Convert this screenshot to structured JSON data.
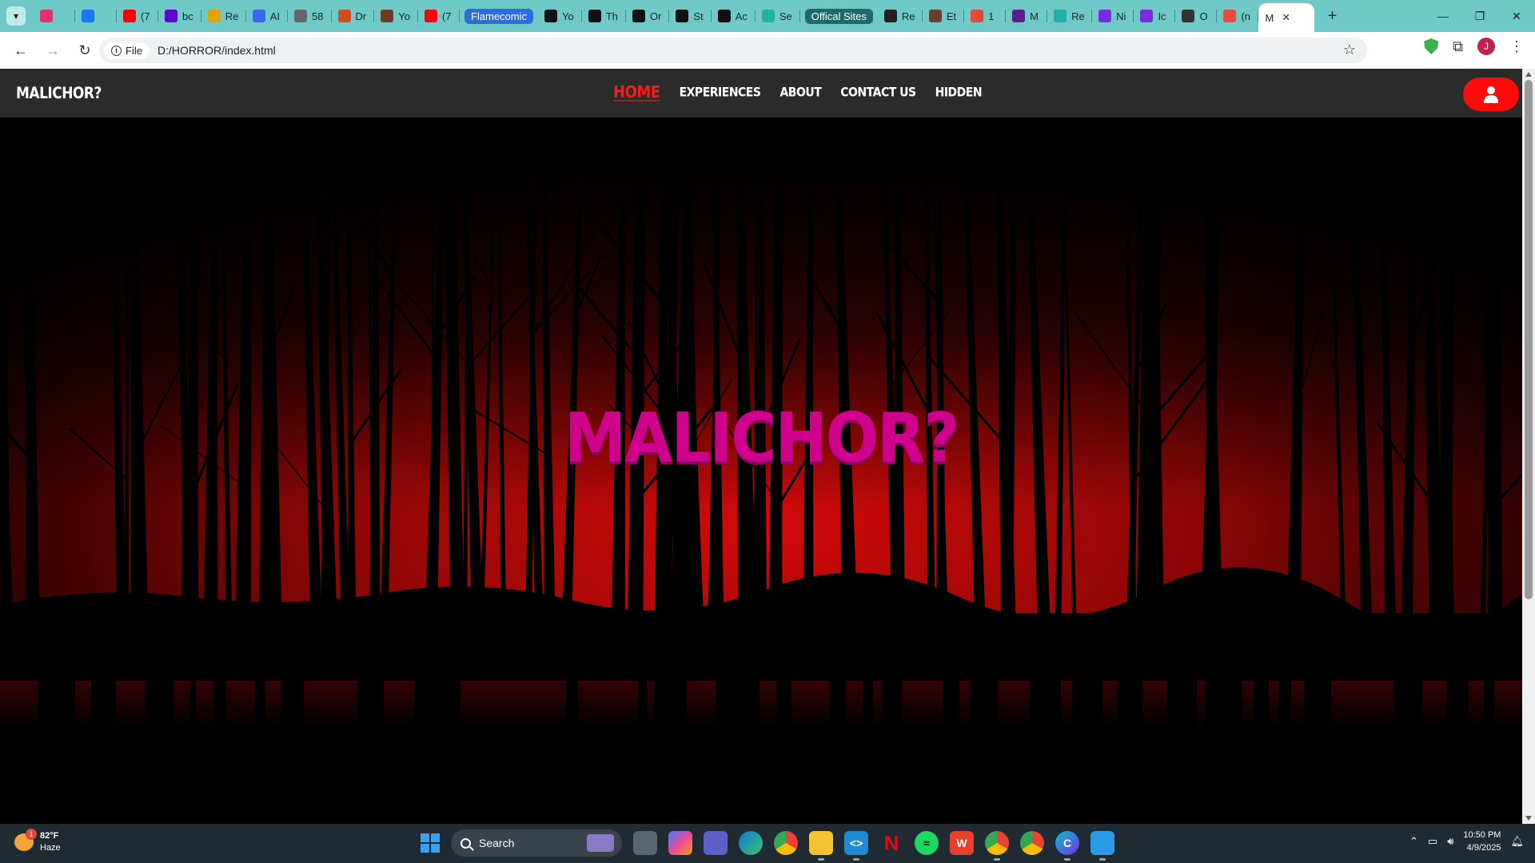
{
  "browser": {
    "tabs": [
      {
        "label": "",
        "icon": "instagram-icon",
        "color": "#e1306c"
      },
      {
        "label": "",
        "icon": "facebook-icon",
        "color": "#1877f2"
      },
      {
        "label": "(7",
        "icon": "youtube-icon",
        "color": "#ff0000"
      },
      {
        "label": "bc",
        "icon": "yahoo-icon",
        "color": "#6001d2"
      },
      {
        "label": "Re",
        "icon": "app-icon",
        "color": "#e0a400"
      },
      {
        "label": "AI",
        "icon": "app-icon",
        "color": "#3a6ae8"
      },
      {
        "label": "58",
        "icon": "app-icon",
        "color": "#666666"
      },
      {
        "label": "Dr",
        "icon": "x-icon",
        "color": "#d44d1c"
      },
      {
        "label": "Yo",
        "icon": "app-icon",
        "color": "#6d3d2a"
      },
      {
        "label": "(7",
        "icon": "youtube-icon",
        "color": "#ff0000"
      }
    ],
    "tab_group_1": {
      "label": "Flamecomic",
      "color": "#2b6de0"
    },
    "tabs_group_1": [
      {
        "label": "Yo",
        "color": "#111111"
      },
      {
        "label": "Th",
        "color": "#111111"
      },
      {
        "label": "Or",
        "color": "#111111"
      },
      {
        "label": "St",
        "color": "#111111"
      },
      {
        "label": "Ac",
        "color": "#111111"
      },
      {
        "label": "Se",
        "color": "#20b2a6"
      }
    ],
    "tab_group_2": {
      "label": "Offical Sites",
      "color": "#1c6b68"
    },
    "tabs_group_2": [
      {
        "label": "Re",
        "color": "#222222"
      },
      {
        "label": "Et",
        "color": "#6b3f2e"
      },
      {
        "label": "1",
        "color": "#e24a3c"
      },
      {
        "label": "M",
        "color": "#5a1e8a"
      },
      {
        "label": "Re",
        "color": "#20b2a6"
      },
      {
        "label": "Ni",
        "color": "#7a2be0"
      },
      {
        "label": "Ic",
        "color": "#7a2be0"
      },
      {
        "label": "O",
        "color": "#333333"
      },
      {
        "label": "(n",
        "color": "#e84b3b"
      }
    ],
    "active_tab": {
      "label": "M"
    },
    "url_chip": "File",
    "url": "D:/HORROR/index.html",
    "profile_initial": "J"
  },
  "site": {
    "brand": "MALICHOR?",
    "menu": [
      "HOME",
      "EXPERIENCES",
      "ABOUT",
      "CONTACT US",
      "HIDDEN"
    ],
    "hero_title": "MALICHOR?",
    "accent": "#ff0a0a",
    "title_color": "#d1008c"
  },
  "taskbar": {
    "weather_temp": "82°F",
    "weather_desc": "Haze",
    "weather_badge": "1",
    "search_label": "Search",
    "time": "10:50 PM",
    "date": "4/9/2025"
  }
}
